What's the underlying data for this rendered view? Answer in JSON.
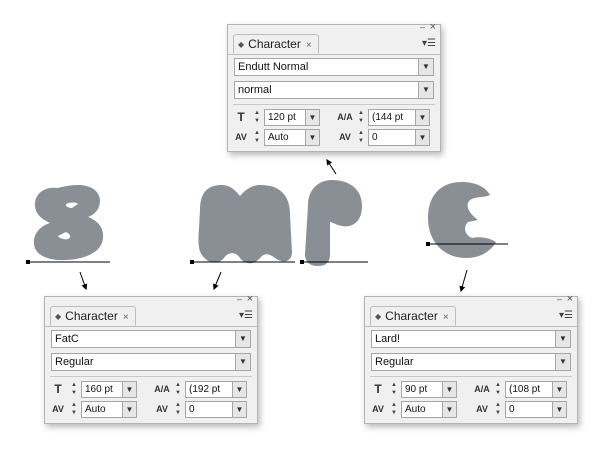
{
  "colors": {
    "glyph_fill": "#8a8f95",
    "panel_bg": "#f0f0f0",
    "field_border": "#a6a6a6",
    "baseline": "#000000"
  },
  "icons": {
    "minimize": "minimize-icon",
    "close": "close-icon",
    "panel_menu": "panel-menu-icon",
    "tab_diamond": "tab-diamond-icon",
    "dropdown": "chevron-down-icon",
    "font_size": "font-size-icon",
    "leading": "leading-icon",
    "kerning": "kerning-icon",
    "tracking": "tracking-icon"
  },
  "panels": {
    "top": {
      "tab_label": "Character",
      "minimize_glyph": "–",
      "close_glyph": "×",
      "tab_close_glyph": "×",
      "font_family": "Endutt Normal",
      "font_style": "normal",
      "size": "120 pt",
      "leading": "(144 pt",
      "kerning": "Auto",
      "tracking": "0"
    },
    "left": {
      "tab_label": "Character",
      "minimize_glyph": "–",
      "close_glyph": "×",
      "tab_close_glyph": "×",
      "font_family": "FatC",
      "font_style": "Regular",
      "size": "160 pt",
      "leading": "(192 pt",
      "kerning": "Auto",
      "tracking": "0"
    },
    "right": {
      "tab_label": "Character",
      "minimize_glyph": "–",
      "close_glyph": "×",
      "tab_close_glyph": "×",
      "font_family": "Lard!",
      "font_style": "Regular",
      "size": "90 pt",
      "leading": "(108 pt",
      "kerning": "Auto",
      "tracking": "0"
    }
  }
}
